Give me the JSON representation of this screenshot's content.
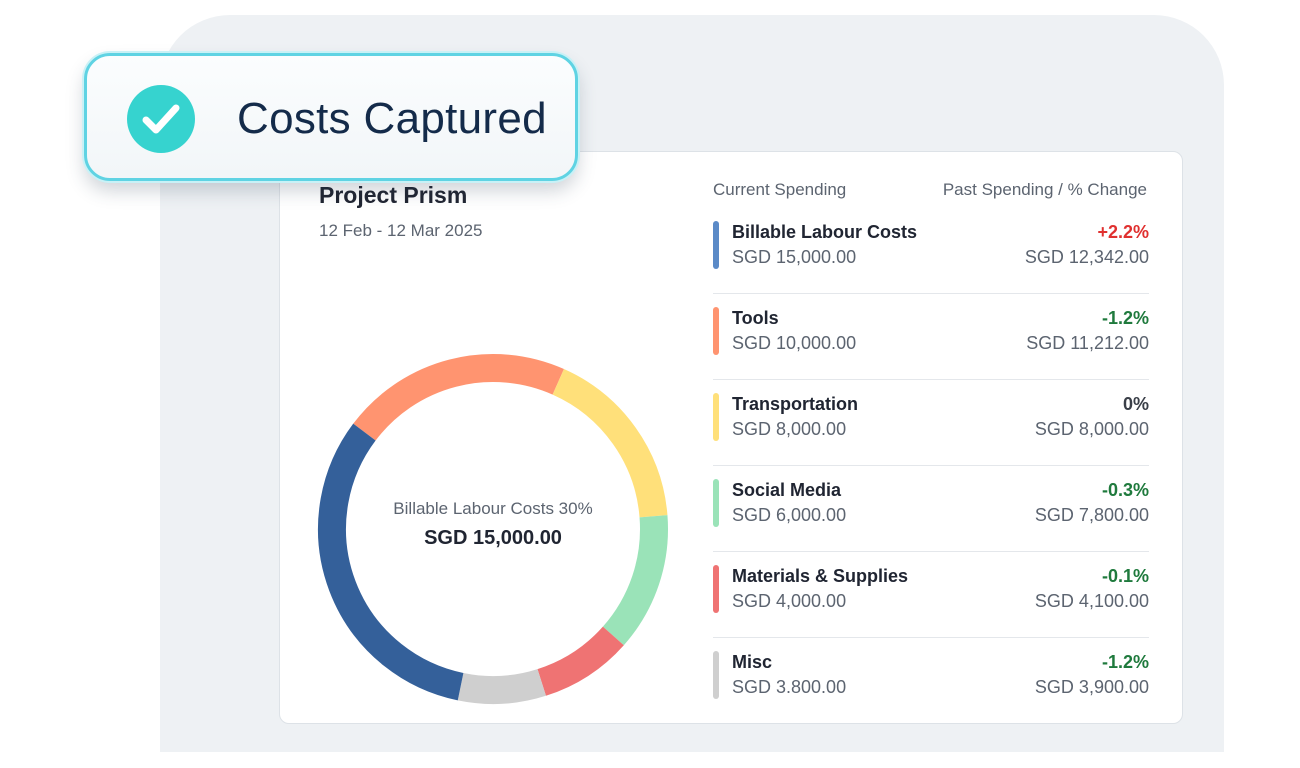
{
  "badge": {
    "label": "Costs Captured",
    "icon": "check-circle-icon",
    "color": "#36d3cf"
  },
  "project": {
    "title": "Project Prism",
    "date_range": "12 Feb - 12 Mar 2025"
  },
  "headers": {
    "current": "Current Spending",
    "past": "Past Spending / % Change"
  },
  "donut_center": {
    "label": "Billable Labour Costs 30%",
    "value": "SGD 15,000.00"
  },
  "items": [
    {
      "name": "Billable Labour Costs",
      "amount": "SGD 15,000.00",
      "change": "+2.2%",
      "past": "SGD 12,342.00",
      "color": "#5b8ac7",
      "change_color": "#e0302f"
    },
    {
      "name": "Tools",
      "amount": "SGD 10,000.00",
      "change": "-1.2%",
      "past": "SGD 11,212.00",
      "color": "#ff9470",
      "change_color": "#1f7a3d"
    },
    {
      "name": "Transportation",
      "amount": "SGD 8,000.00",
      "change": "0%",
      "past": "SGD 8,000.00",
      "color": "#ffe07a",
      "change_color": "#3a3f48"
    },
    {
      "name": "Social Media",
      "amount": "SGD 6,000.00",
      "change": "-0.3%",
      "past": "SGD 7,800.00",
      "color": "#9ae3b8",
      "change_color": "#1f7a3d"
    },
    {
      "name": "Materials & Supplies",
      "amount": "SGD 4,000.00",
      "change": "-0.1%",
      "past": "SGD 4,100.00",
      "color": "#ef7373",
      "change_color": "#1f7a3d"
    },
    {
      "name": "Misc",
      "amount": "SGD 3.800.00",
      "change": "-1.2%",
      "past": "SGD 3,900.00",
      "color": "#cfcfcf",
      "change_color": "#1f7a3d"
    }
  ],
  "donut_segments": [
    {
      "category": "Billable Labour Costs",
      "value": 15000,
      "color": "#34609a"
    },
    {
      "category": "Tools",
      "value": 10000,
      "color": "#ff9470"
    },
    {
      "category": "Transportation",
      "value": 8000,
      "color": "#ffe07a"
    },
    {
      "category": "Social Media",
      "value": 6000,
      "color": "#9ae3b8"
    },
    {
      "category": "Materials & Supplies",
      "value": 4000,
      "color": "#ef7373"
    },
    {
      "category": "Misc",
      "value": 3800,
      "color": "#cfcfcf"
    }
  ]
}
